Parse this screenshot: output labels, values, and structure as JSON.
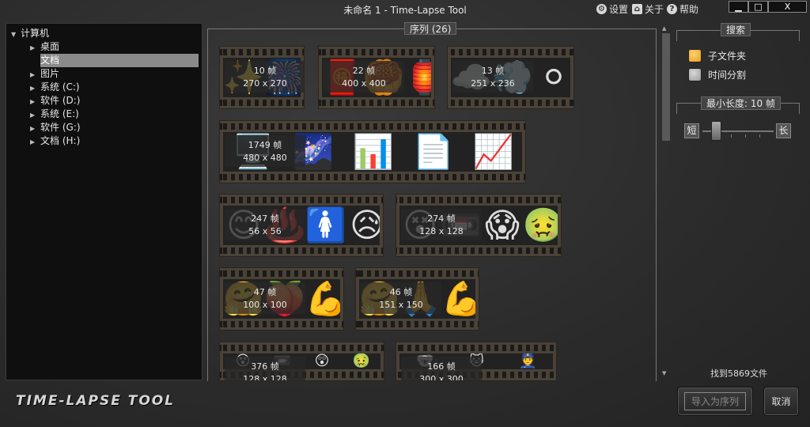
{
  "window": {
    "title": "未命名 1 - Time-Lapse Tool",
    "settings_label": "设置",
    "about_label": "关于",
    "help_label": "帮助",
    "minimize_label": "▁",
    "maximize_label": "□",
    "close_label": "X"
  },
  "tree": {
    "root": "计算机",
    "items": [
      {
        "label": "桌面",
        "selected": false
      },
      {
        "label": "文档",
        "selected": true
      },
      {
        "label": "图片",
        "selected": false
      },
      {
        "label": "系统 (C:)",
        "selected": false
      },
      {
        "label": "软件 (D:)",
        "selected": false
      },
      {
        "label": "系统 (E:)",
        "selected": false
      },
      {
        "label": "软件 (G:)",
        "selected": false
      },
      {
        "label": "文档 (H:)",
        "selected": false
      }
    ]
  },
  "logo": "TIME-LAPSE TOOL",
  "sequence": {
    "label": "序列 (26)",
    "items": [
      {
        "frames": "10 帧",
        "size": "270 x 270",
        "thumbs": [
          "✨",
          "🎆",
          "✨"
        ]
      },
      {
        "frames": "22 帧",
        "size": "400 x 400",
        "thumbs": [
          "🧧",
          "🥮",
          "🏮"
        ]
      },
      {
        "frames": "13 帧",
        "size": "251 x 236",
        "thumbs": [
          "☁️",
          "💨",
          "⚪"
        ]
      },
      {
        "frames": "1749 帧",
        "size": "480 x 480",
        "thumbs": [
          "🖥️",
          "🌌",
          "📊",
          "📄",
          "📈"
        ]
      },
      {
        "frames": "247 帧",
        "size": "56 x 56",
        "thumbs": [
          "😊",
          "♨️",
          "🚺",
          "😥"
        ]
      },
      {
        "frames": "274 帧",
        "size": "128 x 128",
        "thumbs": [
          "😵",
          "📼",
          "😱",
          "🤢"
        ]
      },
      {
        "frames": "47 帧",
        "size": "100 x 100",
        "thumbs": [
          "🤗",
          "🍑",
          "💪"
        ]
      },
      {
        "frames": "46 帧",
        "size": "151 x 150",
        "thumbs": [
          "🤗",
          "🙏",
          "💪"
        ]
      },
      {
        "frames": "376 帧",
        "size": "128 x 128",
        "thumbs": [
          "😵",
          "📼",
          "😲",
          "🤢"
        ]
      },
      {
        "frames": "166 帧",
        "size": "300 x 300",
        "thumbs": [
          "🐨",
          "🐱",
          "👮"
        ]
      }
    ]
  },
  "right_panel": {
    "search_label": "搜索",
    "subfolder_label": "子文件夹",
    "timesplit_label": "时间分割",
    "minlen_label": "最小长度: 10 帧",
    "short_label": "短",
    "long_label": "长",
    "found_text": "找到5869文件",
    "import_label": "导入为序列",
    "cancel_label": "取消",
    "subfolder_color": "#e8a020",
    "timesplit_color": "#9a9a9a"
  }
}
